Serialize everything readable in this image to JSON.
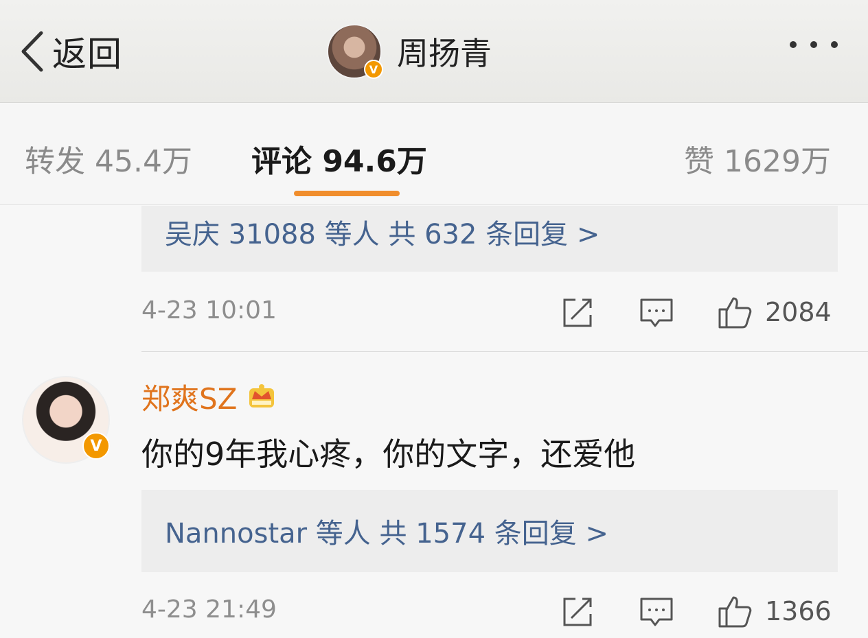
{
  "header": {
    "back_label": "返回",
    "title": "周扬青",
    "verified_badge": "V"
  },
  "tabs": [
    {
      "label": "转发 45.4万",
      "active": false
    },
    {
      "label": "评论 94.6万",
      "active": true
    },
    {
      "label": "赞 1629万",
      "active": false
    }
  ],
  "comments": [
    {
      "replies_summary": "吴庆 31088 等人  共 632 条回复 >",
      "time": "4-23 10:01",
      "likes": "2084"
    },
    {
      "username": "郑爽SZ",
      "verified_badge": "V",
      "text": "你的9年我心疼，你的文字，还爱他",
      "replies_summary": "Nannostar 等人  共 1574 条回复 >",
      "time": "4-23 21:49",
      "likes": "1366"
    }
  ],
  "colors": {
    "accent": "#f08d2c",
    "username": "#e0741d",
    "link": "#45638f",
    "verified": "#f39800"
  },
  "icons": [
    "chevron-left-icon",
    "more-icon",
    "share-icon",
    "comment-icon",
    "thumbs-up-icon",
    "crown-icon"
  ]
}
